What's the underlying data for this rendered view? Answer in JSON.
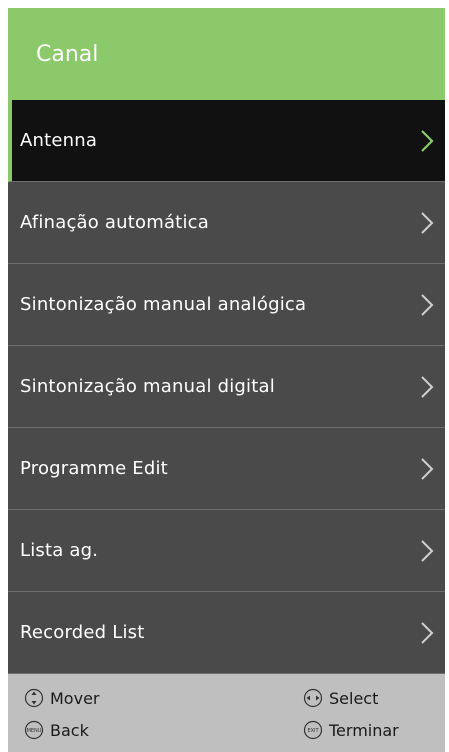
{
  "header": {
    "title": "Canal"
  },
  "menu": {
    "items": [
      {
        "label": "Antenna",
        "selected": true
      },
      {
        "label": "Afinação automática",
        "selected": false
      },
      {
        "label": "Sintonização manual analógica",
        "selected": false
      },
      {
        "label": "Sintonização manual digital",
        "selected": false
      },
      {
        "label": "Programme Edit",
        "selected": false
      },
      {
        "label": "Lista ag.",
        "selected": false
      },
      {
        "label": "Recorded List",
        "selected": false
      }
    ]
  },
  "footer": {
    "move_label": "Mover",
    "select_label": "Select",
    "back_label": "Back",
    "exit_label": "Terminar",
    "menu_key_text": "MENU",
    "exit_key_text": "EXIT"
  },
  "colors": {
    "accent": "#8cc96a",
    "item_bg": "#4a4a4a",
    "selected_bg": "#111111",
    "footer_bg": "#bfbfbf"
  },
  "icons": {
    "chevron": "chevron-right-icon",
    "move": "updown-arrows-icon",
    "select": "leftright-arrows-icon",
    "back": "menu-key-icon",
    "exit": "exit-key-icon"
  }
}
